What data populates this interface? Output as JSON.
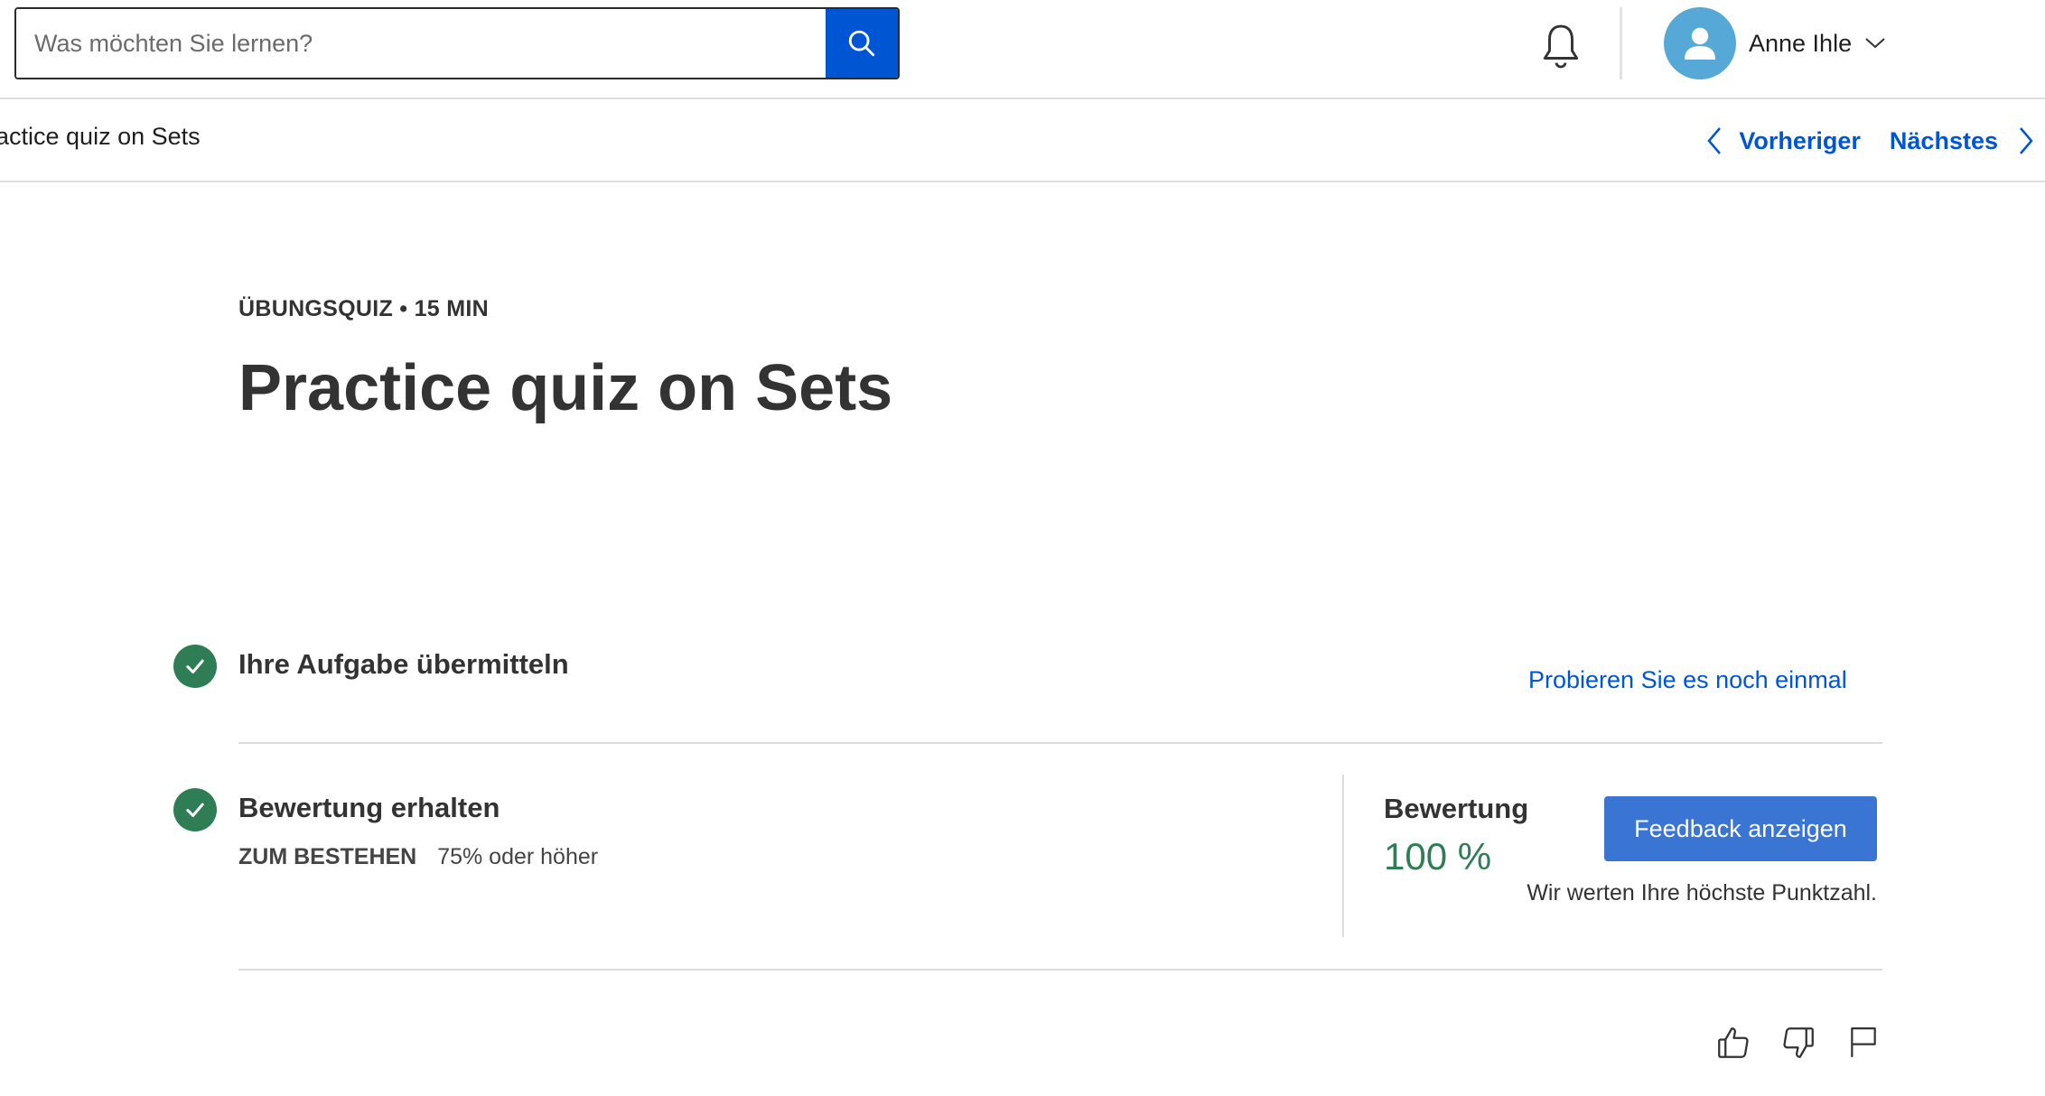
{
  "search": {
    "placeholder": "Was möchten Sie lernen?"
  },
  "header": {
    "user_name": "Anne Ihle"
  },
  "nav": {
    "breadcrumb": "Practice quiz on Sets",
    "previous_label": "Vorheriger",
    "next_label": "Nächstes"
  },
  "page": {
    "eyebrow": "ÜBUNGSQUIZ • 15 MIN",
    "title": "Practice quiz on Sets"
  },
  "steps": {
    "submit": {
      "title": "Ihre Aufgabe übermitteln",
      "retry_link": "Probieren Sie es noch einmal"
    },
    "grade": {
      "title": "Bewertung erhalten",
      "pass_label": "ZUM BESTEHEN",
      "pass_value": "75% oder höher",
      "score_label": "Bewertung",
      "score_value": "100 %",
      "feedback_button": "Feedback anzeigen",
      "note": "Wir werten Ihre höchste Punktzahl."
    }
  },
  "colors": {
    "primary": "#0056d2",
    "success": "#2e7d54",
    "avatar": "#56a9d6"
  },
  "icons": {
    "search": "search-icon",
    "bell": "bell-icon",
    "avatar": "user-icon",
    "chevron": "chevron-down-icon",
    "prev": "chevron-left-icon",
    "next": "chevron-right-icon",
    "check": "check-icon",
    "like": "thumbs-up-icon",
    "dislike": "thumbs-down-icon",
    "report": "flag-icon"
  }
}
